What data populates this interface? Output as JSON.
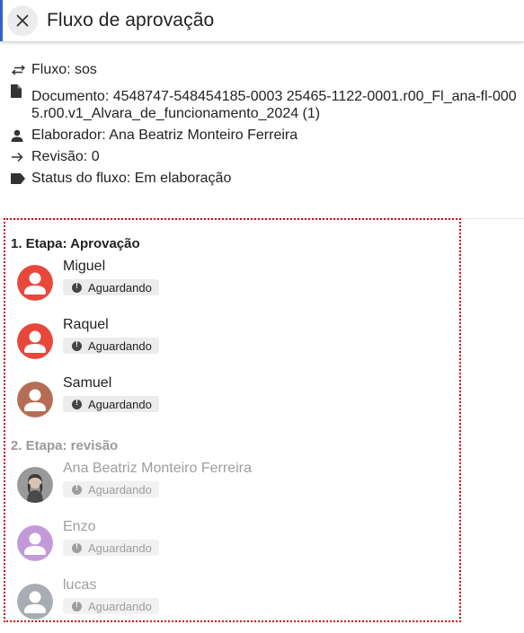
{
  "header": {
    "title": "Fluxo de aprovação",
    "close_icon": "close-icon"
  },
  "info": {
    "flow": "Fluxo: sos",
    "document": "Documento: 4548747-548454185-0003 25465-1122-0001.r00_Fl_ana-fl-0005.r00.v1_Alvara_de_funcionamento_2024 (1)",
    "author": "Elaborador: Ana Beatriz Monteiro Ferreira",
    "revision": "Revisão: 0",
    "status": "Status do fluxo: Em elaboração"
  },
  "stages": [
    {
      "title": "1. Etapa: Aprovação",
      "active": true,
      "people": [
        {
          "name": "Miguel",
          "status": "Aguardando",
          "avatar_color": "#e8473b"
        },
        {
          "name": "Raquel",
          "status": "Aguardando",
          "avatar_color": "#e8473b"
        },
        {
          "name": "Samuel",
          "status": "Aguardando",
          "avatar_color": "#b56e55"
        }
      ]
    },
    {
      "title": "2. Etapa: revisão",
      "active": false,
      "people": [
        {
          "name": "Ana Beatriz Monteiro Ferreira",
          "status": "Aguardando",
          "avatar_color": "#7a7a7a"
        },
        {
          "name": "Enzo",
          "status": "Aguardando",
          "avatar_color": "#c39ad9"
        },
        {
          "name": "lucas",
          "status": "Aguardando",
          "avatar_color": "#a8adb3"
        }
      ]
    }
  ],
  "colors": {
    "accent_border": "#2f63c9",
    "selection_outline": "#d0021b"
  }
}
